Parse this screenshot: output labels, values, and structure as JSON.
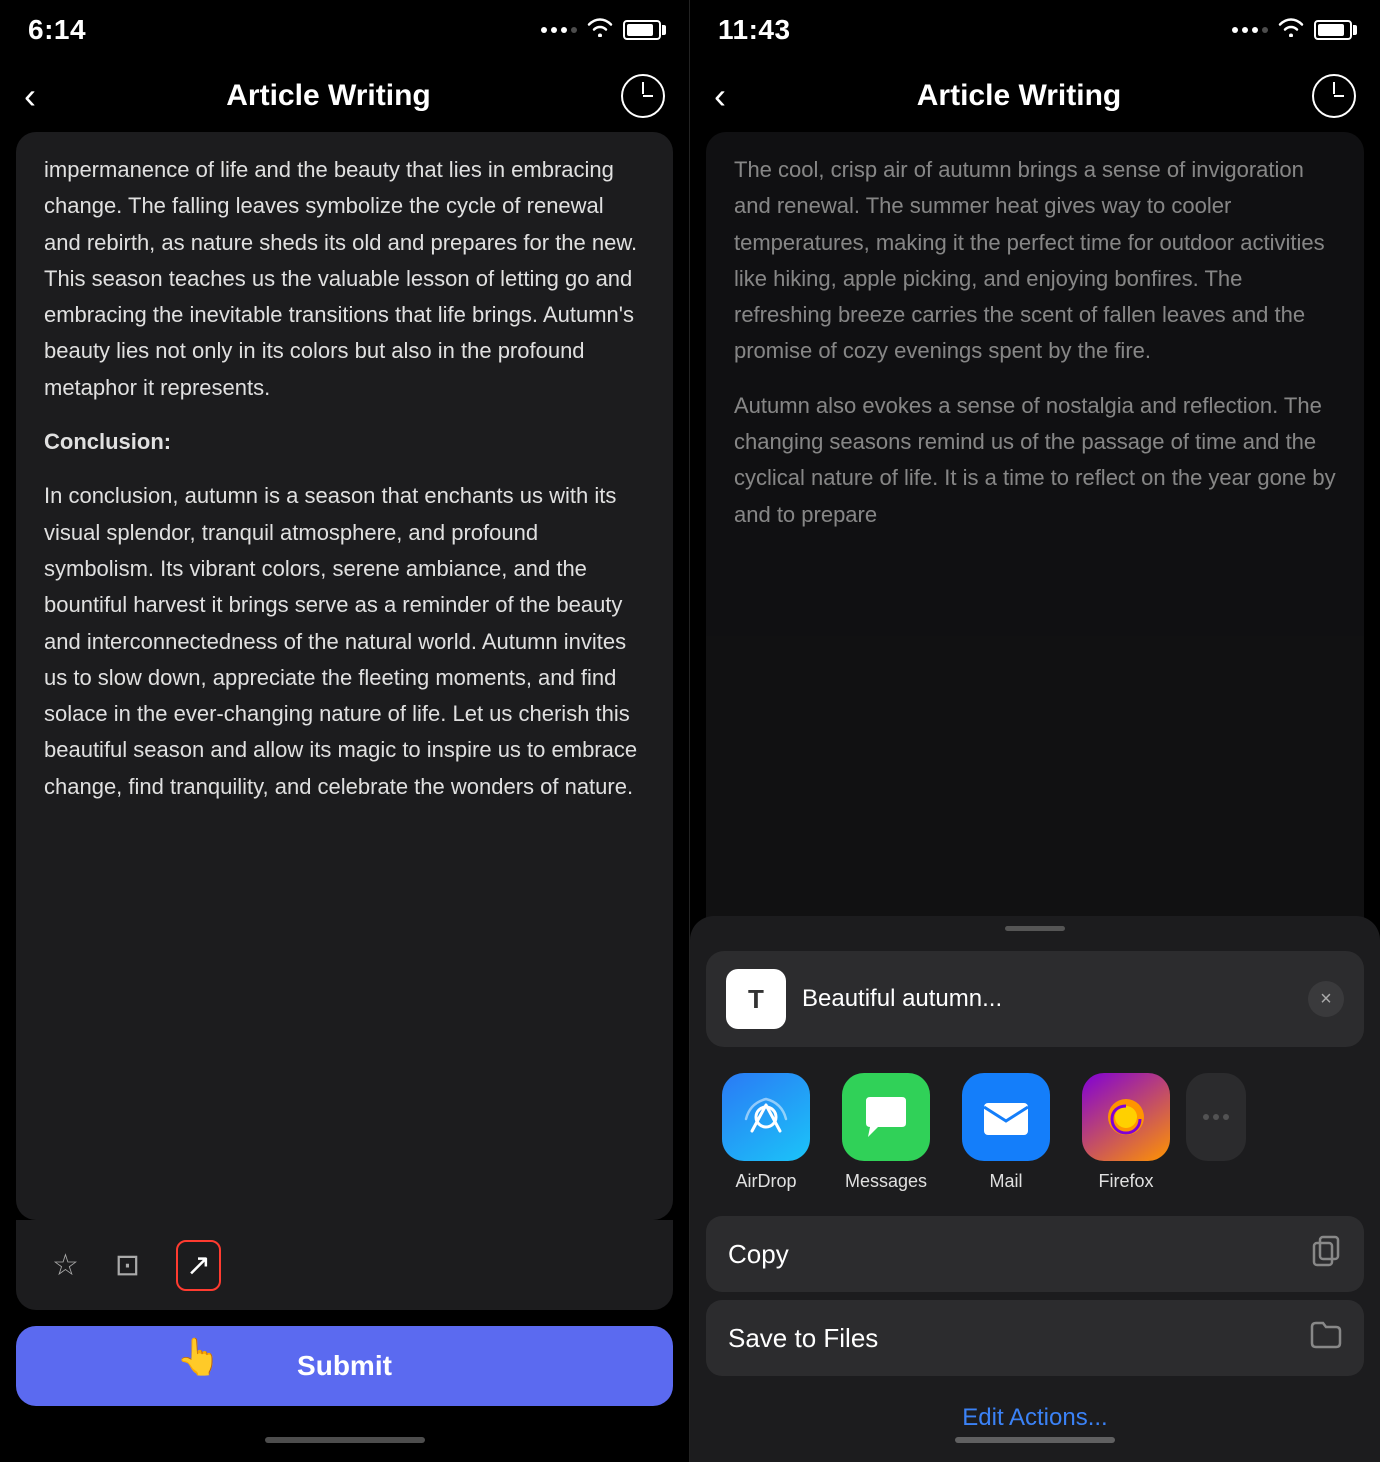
{
  "left_panel": {
    "status": {
      "time": "6:14"
    },
    "nav": {
      "back_label": "‹",
      "title": "Article Writing",
      "clock_label": "clock"
    },
    "article": {
      "paragraphs": [
        "impermanence of life and the beauty that lies in embracing change. The falling leaves symbolize the cycle of renewal and rebirth, as nature sheds its old and prepares for the new. This season teaches us the valuable lesson of letting go and embracing the inevitable transitions that life brings. Autumn's beauty lies not only in its colors but also in the profound metaphor it represents.",
        "Conclusion:",
        "In conclusion, autumn is a season that enchants us with its visual splendor, tranquil atmosphere, and profound symbolism. Its vibrant colors, serene ambiance, and the bountiful harvest it brings serve as a reminder of the beauty and interconnectedness of the natural world. Autumn invites us to slow down, appreciate the fleeting moments, and find solace in the ever-changing nature of life. Let us cherish this beautiful season and allow its magic to inspire us to embrace change, find tranquility, and celebrate the wonders of nature."
      ]
    },
    "action_icons": {
      "star": "☆",
      "copy": "⊡",
      "share": "↗"
    },
    "submit_label": "Submit"
  },
  "right_panel": {
    "status": {
      "time": "11:43"
    },
    "nav": {
      "back_label": "‹",
      "title": "Article Writing",
      "clock_label": "clock"
    },
    "article": {
      "paragraphs": [
        "The cool, crisp air of autumn brings a sense of invigoration and renewal. The summer heat gives way to cooler temperatures, making it the perfect time for outdoor activities like hiking, apple picking, and enjoying bonfires. The refreshing breeze carries the scent of fallen leaves and the promise of cozy evenings spent by the fire.",
        "Autumn also evokes a sense of nostalgia and reflection. The changing seasons remind us of the passage of time and the cyclical nature of life. It is a time to reflect on the year gone by and to prepare"
      ]
    },
    "share_sheet": {
      "preview_title": "Beautiful autumn...",
      "preview_icon": "T",
      "close_label": "×",
      "apps": [
        {
          "id": "airdrop",
          "label": "AirDrop",
          "icon": "📡",
          "type": "airdrop"
        },
        {
          "id": "messages",
          "label": "Messages",
          "icon": "💬",
          "type": "messages"
        },
        {
          "id": "mail",
          "label": "Mail",
          "icon": "✉",
          "type": "mail"
        },
        {
          "id": "firefox",
          "label": "Firefox",
          "icon": "🦊",
          "type": "firefox"
        }
      ],
      "actions": [
        {
          "id": "copy",
          "label": "Copy",
          "icon": "⊡"
        },
        {
          "id": "save_files",
          "label": "Save to Files",
          "icon": "🗂"
        }
      ],
      "edit_actions_label": "Edit Actions..."
    }
  }
}
